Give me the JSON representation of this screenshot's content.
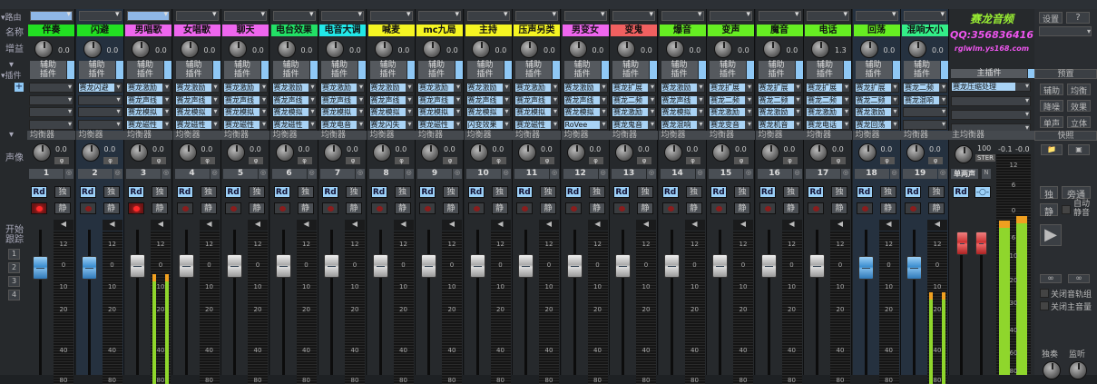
{
  "left_labels": {
    "route": "▾路由",
    "name": "名称",
    "gain": "增益",
    "aux": "▾",
    "plugin": "插件",
    "plugin_arrow": "▾",
    "add": "+",
    "eq_arrow": "▾",
    "pan": "声像",
    "start_track": "开始\n跟踪",
    "track_buttons": [
      "1",
      "2",
      "3",
      "4"
    ]
  },
  "common": {
    "aux": "辅助",
    "plugin": "插件",
    "eq": "均衡器",
    "rd": "Rd",
    "solo": "独",
    "mute": "静",
    "phase": "φ",
    "scale": [
      "12",
      "0",
      "10",
      "20",
      "40",
      "80"
    ]
  },
  "channels": [
    {
      "num": "1",
      "name": "伴奏",
      "color": "#22e022",
      "gain": "0.0",
      "pan": "0.0",
      "plugins": [
        "",
        "",
        "",
        ""
      ],
      "rec": true,
      "fader": "blue",
      "hl": false,
      "route_sel": true,
      "level": 0
    },
    {
      "num": "2",
      "name": "闪避",
      "color": "#22e022",
      "gain": "0.0",
      "pan": "0.0",
      "plugins": [
        "赛龙闪避",
        "",
        "",
        ""
      ],
      "rec": false,
      "fader": "blue",
      "hl": true,
      "route_sel": false,
      "level": 0
    },
    {
      "num": "3",
      "name": "男唱歌",
      "color": "#ee66ee",
      "gain": "0.0",
      "pan": "0.0",
      "plugins": [
        "赛龙激励",
        "赛龙声线",
        "赛龙模拟",
        "赛龙磁性"
      ],
      "rec": true,
      "fader": "white",
      "hl": false,
      "route_sel": true,
      "level": 0.72
    },
    {
      "num": "4",
      "name": "女唱歌",
      "color": "#ee66ee",
      "gain": "0.0",
      "pan": "0.0",
      "plugins": [
        "赛龙激励",
        "赛龙声线",
        "赛龙模拟",
        "赛龙磁性"
      ],
      "rec": false,
      "fader": "white",
      "hl": false,
      "route_sel": false,
      "level": 0
    },
    {
      "num": "5",
      "name": "聊天",
      "color": "#ee66ee",
      "gain": "0.0",
      "pan": "0.0",
      "plugins": [
        "赛龙激励",
        "赛龙声线",
        "赛龙模拟",
        "赛龙磁性"
      ],
      "rec": false,
      "fader": "white",
      "hl": false,
      "route_sel": false,
      "level": 0
    },
    {
      "num": "6",
      "name": "电台效果",
      "color": "#22e066",
      "gain": "0.0",
      "pan": "0.0",
      "plugins": [
        "赛龙激励",
        "赛龙声线",
        "赛龙模拟",
        "赛龙磁性"
      ],
      "rec": false,
      "fader": "white",
      "hl": false,
      "route_sel": false,
      "level": 0
    },
    {
      "num": "7",
      "name": "电音大调",
      "color": "#22e8e8",
      "gain": "0.0",
      "pan": "0.0",
      "plugins": [
        "赛龙激励",
        "赛龙声线",
        "赛龙模拟",
        "赛龙电音"
      ],
      "rec": false,
      "fader": "white",
      "hl": false,
      "route_sel": false,
      "level": 0
    },
    {
      "num": "8",
      "name": "喊麦",
      "color": "#f5f522",
      "gain": "0.0",
      "pan": "0.0",
      "plugins": [
        "赛龙激励",
        "赛龙声线",
        "赛龙模拟",
        "赛龙闪失"
      ],
      "rec": false,
      "fader": "white",
      "hl": false,
      "route_sel": false,
      "level": 0
    },
    {
      "num": "9",
      "name": "mc九局",
      "color": "#f5f522",
      "gain": "0.0",
      "pan": "0.0",
      "plugins": [
        "赛龙激励",
        "赛龙声线",
        "赛龙模拟",
        "赛龙磁性"
      ],
      "rec": false,
      "fader": "white",
      "hl": false,
      "route_sel": false,
      "level": 0
    },
    {
      "num": "10",
      "name": "主持",
      "color": "#f5f522",
      "gain": "0.0",
      "pan": "0.0",
      "plugins": [
        "赛龙激励",
        "赛龙声线",
        "赛龙模拟",
        "闪变效果"
      ],
      "rec": false,
      "fader": "white",
      "hl": false,
      "route_sel": false,
      "level": 0
    },
    {
      "num": "11",
      "name": "压声另类",
      "color": "#f5f522",
      "gain": "0.0",
      "pan": "0.0",
      "plugins": [
        "赛龙激励",
        "赛龙声线",
        "赛龙模拟",
        "赛龙磁性"
      ],
      "rec": false,
      "fader": "white",
      "hl": false,
      "route_sel": false,
      "level": 0
    },
    {
      "num": "12",
      "name": "男变女",
      "color": "#ee66ee",
      "gain": "0.0",
      "pan": "0.0",
      "plugins": [
        "赛龙激励",
        "赛龙声线",
        "赛龙模拟",
        "RoVee"
      ],
      "rec": false,
      "fader": "white",
      "hl": false,
      "route_sel": false,
      "level": 0
    },
    {
      "num": "13",
      "name": "变鬼",
      "color": "#f06060",
      "gain": "0.0",
      "pan": "0.0",
      "plugins": [
        "赛龙扩展",
        "赛龙二频",
        "赛龙激励",
        "赛龙鬼音"
      ],
      "rec": false,
      "fader": "white",
      "hl": false,
      "route_sel": false,
      "level": 0
    },
    {
      "num": "14",
      "name": "爆音",
      "color": "#66ee22",
      "gain": "0.0",
      "pan": "0.0",
      "plugins": [
        "赛龙激励",
        "赛龙声线",
        "赛龙模拟",
        "赛龙混响"
      ],
      "rec": false,
      "fader": "white",
      "hl": false,
      "route_sel": false,
      "level": 0
    },
    {
      "num": "15",
      "name": "变声",
      "color": "#66ee22",
      "gain": "0.0",
      "pan": "0.0",
      "plugins": [
        "赛龙扩展",
        "赛龙二频",
        "赛龙激励",
        "赛龙变音"
      ],
      "rec": false,
      "fader": "white",
      "hl": false,
      "route_sel": false,
      "level": 0
    },
    {
      "num": "16",
      "name": "魔音",
      "color": "#66ee22",
      "gain": "0.0",
      "pan": "0.0",
      "plugins": [
        "赛龙扩展",
        "赛龙二频",
        "赛龙激励",
        "赛龙机音"
      ],
      "rec": false,
      "fader": "white",
      "hl": false,
      "route_sel": false,
      "level": 0
    },
    {
      "num": "17",
      "name": "电话",
      "color": "#66ee22",
      "gain": "1.3",
      "pan": "0.0",
      "plugins": [
        "赛龙扩展",
        "赛龙二频",
        "赛龙激励",
        "赛龙电话"
      ],
      "rec": false,
      "fader": "white",
      "hl": false,
      "route_sel": false,
      "level": 0
    },
    {
      "num": "18",
      "name": "回荡",
      "color": "#66ee22",
      "gain": "0.0",
      "pan": "0.0",
      "plugins": [
        "赛龙扩展",
        "赛龙二频",
        "赛龙激励",
        "赛龙回荡"
      ],
      "rec": false,
      "fader": "blue",
      "hl": true,
      "route_sel": false,
      "level": 0
    },
    {
      "num": "19",
      "name": "混响大小",
      "color": "#33ee88",
      "gain": "0.0",
      "pan": "0.0",
      "plugins": [
        "赛龙二频",
        "赛龙混响",
        "",
        ""
      ],
      "rec": false,
      "fader": "blue",
      "hl": true,
      "route_sel": false,
      "level": 0.6
    }
  ],
  "brand": {
    "title": "赛龙音频",
    "qq": "QQ:356836416",
    "site": "rglwlm.ys168.com"
  },
  "master": {
    "plugin_header": "主插件",
    "plugin": "赛龙压缩处理",
    "eq": "主均衡器",
    "pan": "100",
    "stereo": "STER",
    "label": "单两声",
    "n": "N",
    "rd": "Rd",
    "link": "-○-",
    "peak_l": "-0.1",
    "peak_r": "-0.0",
    "meter_scale": [
      "12",
      "6",
      "0",
      "6",
      "10",
      "20",
      "30",
      "40",
      "60",
      "80"
    ],
    "level_l": 0.7,
    "level_r": 0.72
  },
  "right": {
    "settings": "设置",
    "help": "?",
    "preset_header": "预置",
    "buttons": [
      "辅助",
      "均衡",
      "降噪",
      "效果",
      "单声",
      "立体"
    ],
    "snapshot": "快照",
    "solo": "独",
    "bypass": "旁通",
    "mute": "静",
    "auto_mute": "自动\n静音",
    "play": "▶",
    "link1": "∞",
    "link2": "∞",
    "close_group": "关闭音轨组",
    "close_master": "关闭主音量",
    "solo_knob": "独奏",
    "monitor": "监听"
  }
}
